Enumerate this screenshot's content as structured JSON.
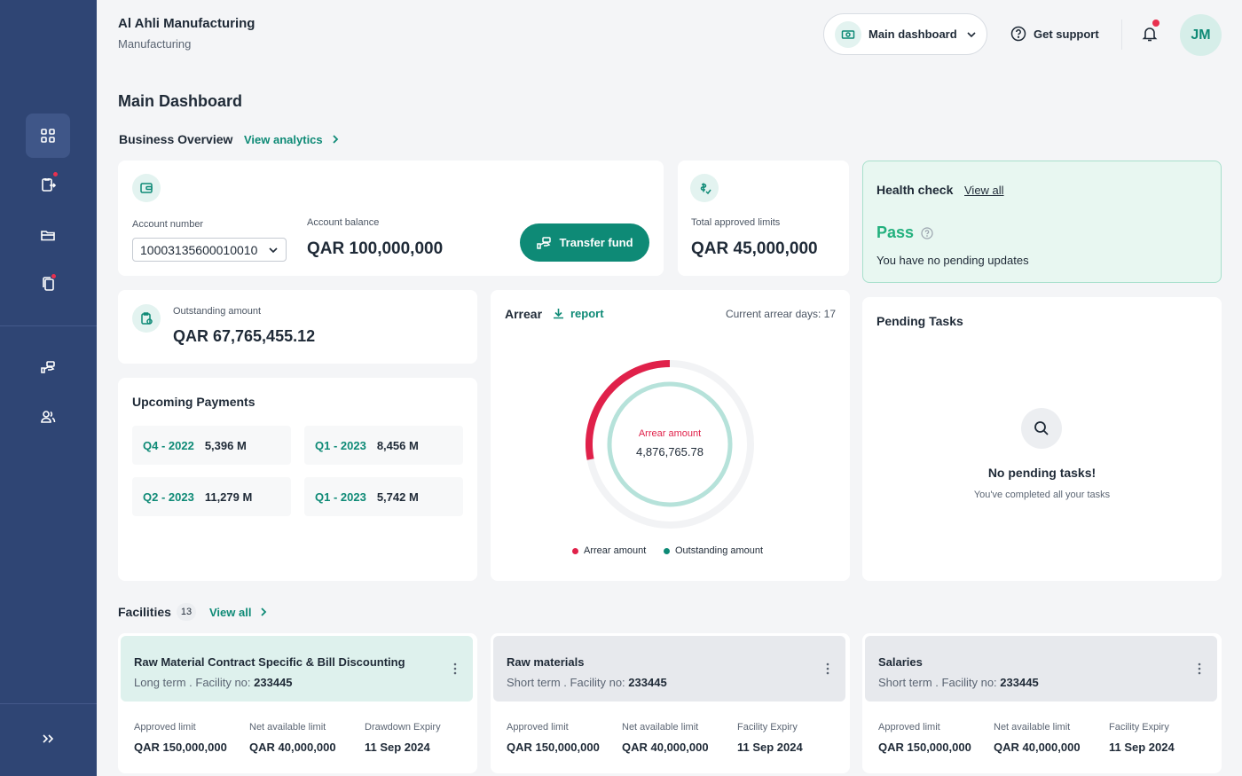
{
  "company": {
    "name": "Al Ahli Manufacturing",
    "subtitle": "Manufacturing"
  },
  "header": {
    "dashboard_select": "Main dashboard",
    "support_label": "Get support",
    "avatar_initials": "JM"
  },
  "page_title": "Main Dashboard",
  "business_overview": {
    "title": "Business Overview",
    "link": "View analytics"
  },
  "account": {
    "number_label": "Account number",
    "number_value": "10003135600010010",
    "balance_label": "Account balance",
    "balance_value": "QAR 100,000,000",
    "transfer_label": "Transfer fund"
  },
  "limits": {
    "label": "Total approved limits",
    "value": "QAR 45,000,000"
  },
  "health": {
    "title": "Health check",
    "link": "View all",
    "status": "Pass",
    "message": "You have no pending updates"
  },
  "outstanding": {
    "label": "Outstanding amount",
    "value": "QAR 67,765,455.12"
  },
  "upcoming": {
    "title": "Upcoming Payments",
    "items": [
      {
        "quarter": "Q4 - 2022",
        "value": "5,396 M"
      },
      {
        "quarter": "Q1 - 2023",
        "value": "8,456 M"
      },
      {
        "quarter": "Q2 - 2023",
        "value": "11,279 M"
      },
      {
        "quarter": "Q1 - 2023",
        "value": "5,742 M"
      }
    ]
  },
  "arrear": {
    "title": "Arrear",
    "report_link": "report",
    "days_text": "Current arrear days: 17",
    "center_label": "Arrear amount",
    "center_value": "4,876,765.78",
    "arrear_fraction": 0.28,
    "legend": [
      "Arrear amount",
      "Outstanding amount"
    ],
    "colors": {
      "arrear": "#e0214a",
      "outstanding": "#0e8a76",
      "outstanding_ring": "#b6e2da",
      "track": "#f2f3f5"
    }
  },
  "pending": {
    "title": "Pending Tasks",
    "empty_title": "No pending tasks!",
    "empty_sub": "You've completed all your tasks"
  },
  "facilities": {
    "title": "Facilities",
    "count": "13",
    "link": "View all",
    "items": [
      {
        "name": "Raw Material Contract Specific & Bill Discounting",
        "term": "Long term",
        "facility_label": "Facility no:",
        "facility_no": "233445",
        "cols": [
          {
            "label": "Approved limit",
            "value": "QAR 150,000,000"
          },
          {
            "label": "Net available limit",
            "value": "QAR 40,000,000"
          },
          {
            "label": "Drawdown Expiry",
            "value": "11 Sep 2024"
          }
        ]
      },
      {
        "name": "Raw materials",
        "term": "Short term",
        "facility_label": "Facility no:",
        "facility_no": "233445",
        "cols": [
          {
            "label": "Approved limit",
            "value": "QAR 150,000,000"
          },
          {
            "label": "Net available limit",
            "value": "QAR 40,000,000"
          },
          {
            "label": "Facility Expiry",
            "value": "11 Sep 2024"
          }
        ]
      },
      {
        "name": "Salaries",
        "term": "Short term",
        "facility_label": "Facility no:",
        "facility_no": "233445",
        "cols": [
          {
            "label": "Approved limit",
            "value": "QAR 150,000,000"
          },
          {
            "label": "Net available limit",
            "value": "QAR 40,000,000"
          },
          {
            "label": "Facility Expiry",
            "value": "11 Sep 2024"
          }
        ]
      }
    ]
  },
  "colors": {
    "sidebar": "#2f4574",
    "accent": "#0e8a76",
    "alert": "#e8304f",
    "pass": "#22b07d"
  }
}
